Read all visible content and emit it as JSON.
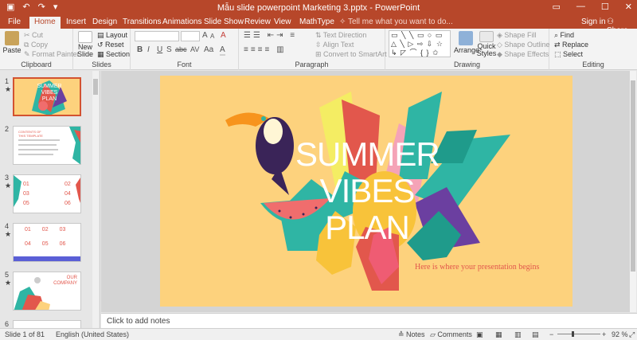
{
  "window": {
    "title": "Mẫu slide powerpoint Marketing 3.pptx - PowerPoint",
    "qat_save": "▣",
    "qat_undo": "↶",
    "qat_redo": "↷",
    "qat_customize": "▾",
    "ctl_ribbon": "▭",
    "ctl_min": "—",
    "ctl_max": "☐",
    "ctl_close": "✕"
  },
  "tabs": [
    "File",
    "Home",
    "Insert",
    "Design",
    "Transitions",
    "Animations",
    "Slide Show",
    "Review",
    "View",
    "MathType"
  ],
  "tell_me": "Tell me what you want to do...",
  "sign_in": "Sign in",
  "share": "Share",
  "ribbon": {
    "clipboard": {
      "paste": "Paste",
      "cut": "Cut",
      "copy": "Copy",
      "format_painter": "Format Painter",
      "label": "Clipboard"
    },
    "slides": {
      "new_slide_1": "New",
      "new_slide_2": "Slide",
      "layout": "Layout",
      "reset": "Reset",
      "section": "Section",
      "label": "Slides"
    },
    "font": {
      "label": "Font",
      "bold": "B",
      "italic": "I",
      "underline": "U",
      "strike": "S",
      "abc": "abc",
      "av": "AV",
      "aa": "Aa",
      "color_a": "A",
      "grow": "A",
      "shrink": "A",
      "clear": "A"
    },
    "paragraph": {
      "text_direction": "Text Direction",
      "align_text": "Align Text",
      "convert_smartart": "Convert to SmartArt",
      "label": "Paragraph"
    },
    "drawing": {
      "arrange": "Arrange",
      "quick_1": "Quick",
      "quick_2": "Styles",
      "shape_fill": "Shape Fill",
      "shape_outline": "Shape Outline",
      "shape_effects": "Shape Effects",
      "label": "Drawing",
      "shapes_row1": "▭ ╲ ╲ ▭ ○ ▭",
      "shapes_row2": "△ ╲ ▷ ⇨ ⇩ ☆",
      "shapes_row3": "↳ ◸ ⌒ { } ✩"
    },
    "editing": {
      "find": "Find",
      "replace": "Replace",
      "select": "Select",
      "label": "Editing"
    }
  },
  "thumbnails": [
    {
      "num": "1",
      "star": "★",
      "line1": "SUMMER",
      "line2": "VIBES",
      "line3": "PLAN"
    },
    {
      "num": "2",
      "star": "",
      "title": "CONTENTS OF",
      "subtitle": "THIS TEMPLATE"
    },
    {
      "num": "3",
      "star": "★",
      "n1": "01",
      "n2": "02",
      "n3": "03",
      "n4": "04",
      "n5": "05",
      "n6": "06"
    },
    {
      "num": "4",
      "star": "★",
      "n1": "01",
      "n2": "02",
      "n3": "03",
      "n4": "04",
      "n5": "05",
      "n6": "06"
    },
    {
      "num": "5",
      "star": "★",
      "t1": "OUR",
      "t2": "COMPANY"
    },
    {
      "num": "6",
      "star": ""
    }
  ],
  "slide": {
    "title_1": "SUMMER",
    "title_2": "VIBES",
    "title_3": "PLAN",
    "subtitle": "Here is where your presentation begins"
  },
  "notes_placeholder": "Click to add notes",
  "status": {
    "slide_of": "Slide 1 of 81",
    "language": "English (United States)",
    "notes": "Notes",
    "comments": "Comments",
    "zoom": "92 %",
    "zoom_minus": "−",
    "zoom_plus": "+"
  },
  "colors": {
    "accent": "#b7472a",
    "slide_bg": "#fdd27d",
    "subtitle": "#e2574c"
  }
}
